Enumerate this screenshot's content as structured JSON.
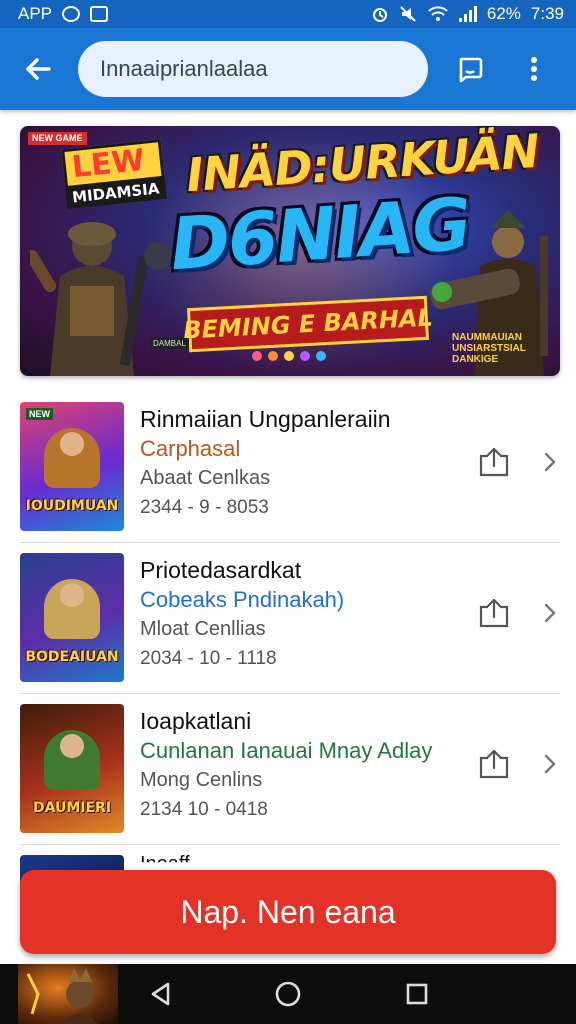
{
  "status_bar": {
    "app_label": "APP",
    "battery": "62%",
    "time": "7:39"
  },
  "app_bar": {
    "search_value": "Innaaiprianlaalaa",
    "icons": [
      "arrow-back-icon",
      "chat-bubble-icon",
      "more-vert-icon"
    ]
  },
  "banner": {
    "badge": "NEW GAME",
    "logo_line1": "LEW",
    "logo_line2": "MIDAMSIA",
    "title_line1": "INÄD:URKUÄN",
    "title_line2": "D6NIAG",
    "subtitle": "BEMING E BARHAL",
    "fine_print_left": "DAMBAL",
    "fine_print_right": "NAUMMAUIAN UNSIARSTSIAL DANKIGE",
    "carousel_dots": [
      "#ff5c8a",
      "#ff8a3d",
      "#ffd23f",
      "#b05cff",
      "#3db4ff"
    ]
  },
  "items": [
    {
      "thumb_title": "IOUDIMUAN",
      "thumb_tag": "NEW",
      "thumb_colors": [
        "#e1436e",
        "#6a2bd1",
        "#1b8bd6"
      ],
      "figure_color": "#b8742a",
      "title": "Rinmaiian Ungpanleraiin",
      "subtitle": "Carphasal",
      "subtitle_color": "#c0541a",
      "meta": "Abaat Cenlkas",
      "date": "2344 - 9 - 8053"
    },
    {
      "thumb_title": "BODEAIUAN",
      "thumb_tag": "",
      "thumb_colors": [
        "#2a3f8f",
        "#5c2ea8",
        "#1f79c9"
      ],
      "figure_color": "#c9a55b",
      "title": "Priotedasardkat",
      "subtitle": "Cobeaks Pndinakah)",
      "subtitle_color": "#1f6fd1",
      "meta": "Mloat Cenllias",
      "date": "2034 - 10 - 1118"
    },
    {
      "thumb_title": "DAUMIERI",
      "thumb_tag": "",
      "thumb_colors": [
        "#3d1c0b",
        "#a8321b",
        "#e0892a"
      ],
      "figure_color": "#3f7a2e",
      "title": "Ioapkatlani",
      "subtitle": "Cunlanan Ianauai Mnay Adlay",
      "subtitle_color": "#1f7a3a",
      "meta": "Mong Cenlins",
      "date": "2134 10 - 0418"
    }
  ],
  "partial_item": {
    "title": "Inoaff"
  },
  "cta": {
    "label": "Nap. Nen eana"
  },
  "nav_bar": {
    "icons": [
      "back-triangle-icon",
      "home-circle-icon",
      "recents-square-icon"
    ]
  }
}
